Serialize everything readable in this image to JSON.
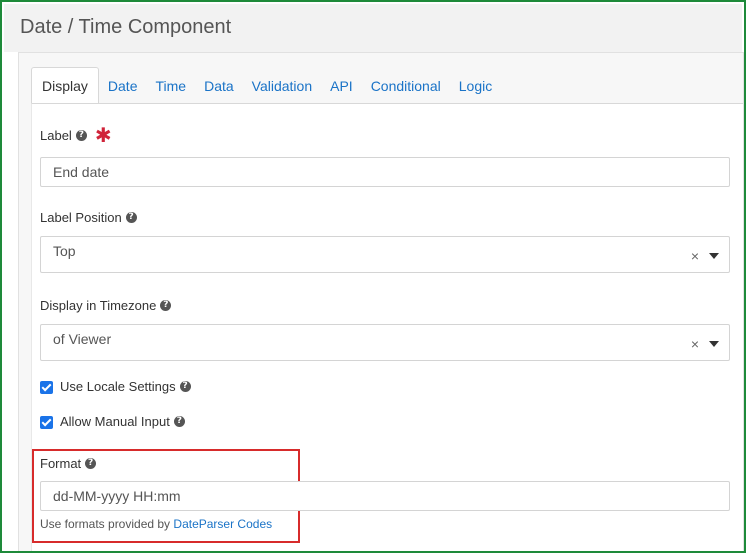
{
  "dialog": {
    "title": "Date / Time Component"
  },
  "tabs": [
    {
      "label": "Display",
      "active": true
    },
    {
      "label": "Date"
    },
    {
      "label": "Time"
    },
    {
      "label": "Data"
    },
    {
      "label": "Validation"
    },
    {
      "label": "API"
    },
    {
      "label": "Conditional"
    },
    {
      "label": "Logic"
    }
  ],
  "fields": {
    "label": {
      "label": "Label",
      "value": "End date",
      "required_mark": "✱"
    },
    "label_position": {
      "label": "Label Position",
      "value": "Top"
    },
    "timezone": {
      "label": "Display in Timezone",
      "value": "of Viewer"
    },
    "use_locale": {
      "label": "Use Locale Settings",
      "checked": true
    },
    "manual_input": {
      "label": "Allow Manual Input",
      "checked": true
    },
    "format": {
      "label": "Format",
      "value": "dd-MM-yyyy HH:mm",
      "hint_prefix": "Use formats provided by",
      "hint_link": "DateParser Codes"
    }
  },
  "icons": {
    "help": "?",
    "clear": "×"
  },
  "colors": {
    "accent": "#1a73e8",
    "link": "#1a73c7",
    "required": "#d0243a",
    "highlight": "#d72b2b",
    "frame": "#1e8a3a"
  }
}
